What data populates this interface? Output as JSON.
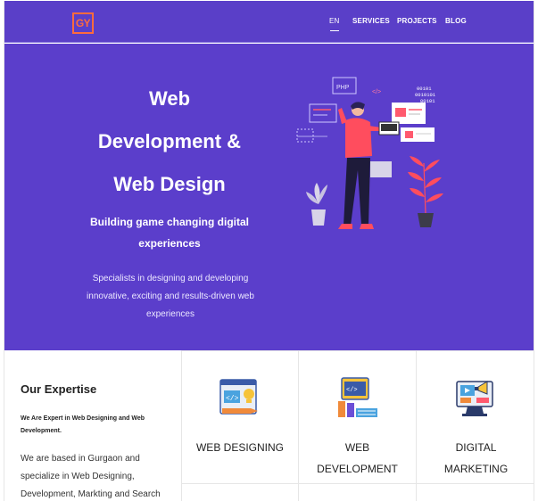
{
  "brand": {
    "logo_text": "GY",
    "accent": "#ff6b3d"
  },
  "nav": {
    "lang": "EN",
    "items": [
      "SERVICES",
      "PROJECTS",
      "BLOG"
    ]
  },
  "hero": {
    "title_lines": [
      "Web",
      "Development &",
      "Web Design"
    ],
    "subtitle_lines": [
      "Building game changing digital",
      "experiences"
    ],
    "description_lines": [
      "Specialists in designing and developing",
      "innovative, exciting and results-driven web",
      "experiences"
    ],
    "background": "#5b3ecb",
    "illustration": {
      "php_label": "PHP",
      "code_label": "</>",
      "binary_lines": [
        "00101",
        "0010101",
        "00101"
      ]
    }
  },
  "expertise": {
    "title": "Our Expertise",
    "bold_lines": [
      "We Are Expert in Web Designing and Web",
      "Development."
    ],
    "text_lines": [
      "We are based in Gurgaon and",
      "specialize in Web Designing,",
      "Development, Markting and Search"
    ]
  },
  "services": [
    {
      "label_lines": [
        "WEB DESIGNING"
      ],
      "icon": "web-design-icon"
    },
    {
      "label_lines": [
        "WEB",
        "DEVELOPMENT"
      ],
      "icon": "web-development-icon"
    },
    {
      "label_lines": [
        "DIGITAL",
        "MARKETING"
      ],
      "icon": "digital-marketing-icon"
    }
  ]
}
